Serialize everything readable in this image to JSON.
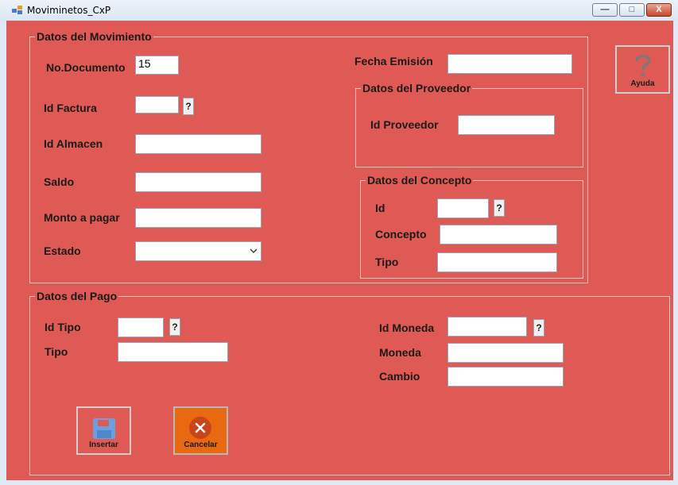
{
  "window": {
    "title": "Moviminetos_CxP",
    "min_glyph": "—",
    "max_glyph": "□",
    "close_glyph": "X"
  },
  "help": {
    "label": "Ayuda",
    "icon": "question-icon"
  },
  "movimiento": {
    "title": "Datos del Movimiento",
    "no_documento_label": "No.Documento",
    "no_documento_value": "15",
    "id_factura_label": "Id Factura",
    "id_almacen_label": "Id Almacen",
    "saldo_label": "Saldo",
    "monto_label": "Monto a pagar",
    "estado_label": "Estado",
    "fecha_label": "Fecha Emisión",
    "lookup_glyph": "?"
  },
  "proveedor": {
    "title": "Datos del Proveedor",
    "id_label": "Id  Proveedor"
  },
  "concepto": {
    "title": "Datos del Concepto",
    "id_label": "Id",
    "concepto_label": "Concepto",
    "tipo_label": "Tipo"
  },
  "pago": {
    "title": "Datos del Pago",
    "id_tipo_label": "Id Tipo",
    "tipo_label": "Tipo",
    "id_moneda_label": "Id Moneda",
    "moneda_label": "Moneda",
    "cambio_label": "Cambio"
  },
  "actions": {
    "insertar_label": "Insertar",
    "cancelar_label": "Cancelar"
  },
  "colors": {
    "background": "#e05a55",
    "cancel_button": "#e8690f",
    "save_icon": "#6a9fe0"
  }
}
